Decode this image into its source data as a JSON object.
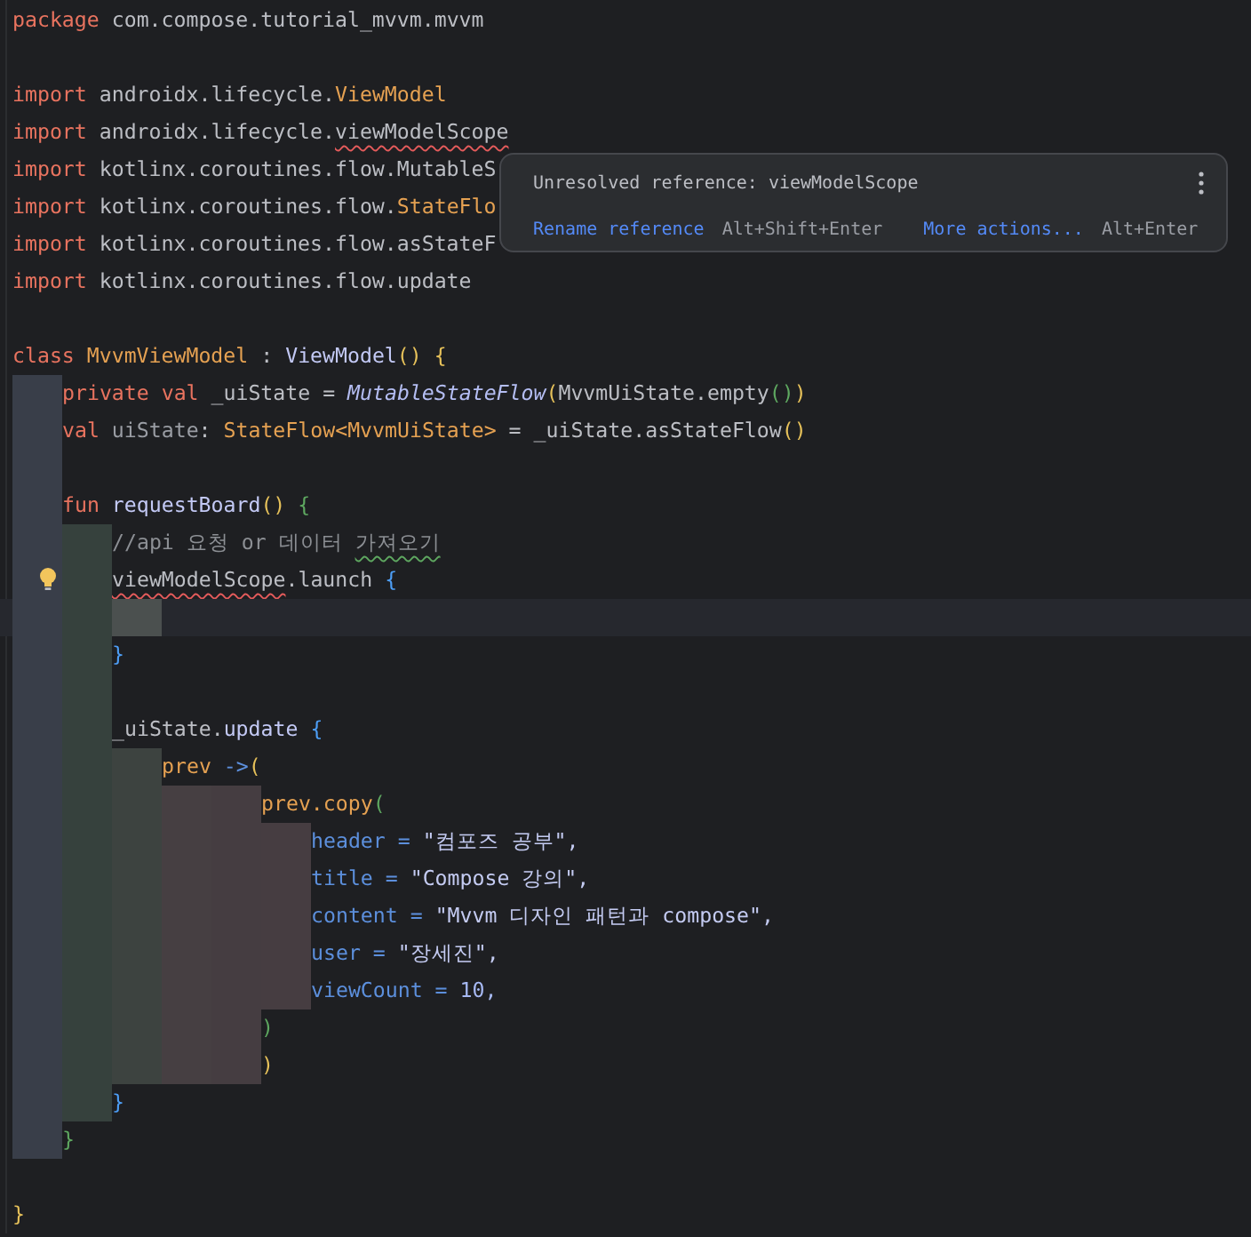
{
  "editor": {
    "lines": [
      {
        "current": false,
        "bulb": false,
        "tokens": [
          {
            "text": "package",
            "kind": "keyword"
          },
          {
            "text": " com.compose.tutorial_mvvm.mvvm",
            "kind": "plain"
          }
        ]
      },
      {
        "current": false,
        "bulb": false
      },
      {
        "current": false,
        "bulb": false,
        "tokens": [
          {
            "text": "import",
            "kind": "keyword"
          },
          {
            "text": " androidx.lifecycle.",
            "kind": "plain"
          },
          {
            "text": "ViewModel",
            "kind": "type"
          }
        ]
      },
      {
        "current": false,
        "bulb": false,
        "tokens": [
          {
            "text": "import",
            "kind": "keyword"
          },
          {
            "text": " androidx.lifecycle.",
            "kind": "plain"
          },
          {
            "text": "viewModelScope",
            "kind": "unresolved"
          }
        ]
      },
      {
        "current": false,
        "bulb": false,
        "tokens": [
          {
            "text": "import",
            "kind": "keyword"
          },
          {
            "text": " kotlinx.coroutines.flow.MutableS",
            "kind": "plain"
          }
        ]
      },
      {
        "current": false,
        "bulb": false,
        "tokens": [
          {
            "text": "import",
            "kind": "keyword"
          },
          {
            "text": " kotlinx.coroutines.flow.",
            "kind": "plain"
          },
          {
            "text": "StateFlo",
            "kind": "type"
          }
        ]
      },
      {
        "current": false,
        "bulb": false,
        "tokens": [
          {
            "text": "import",
            "kind": "keyword"
          },
          {
            "text": " kotlinx.coroutines.flow.asStateF",
            "kind": "plain"
          }
        ]
      },
      {
        "current": false,
        "bulb": false,
        "tokens": [
          {
            "text": "import",
            "kind": "keyword"
          },
          {
            "text": " kotlinx.coroutines.flow.update",
            "kind": "plain"
          }
        ]
      },
      {
        "current": false,
        "bulb": false
      },
      {
        "current": false,
        "bulb": false,
        "tokens": [
          {
            "text": "class",
            "kind": "keyword"
          },
          {
            "text": " MvvmViewModel",
            "kind": "type"
          },
          {
            "text": " : ",
            "kind": "plain"
          },
          {
            "text": "ViewModel",
            "kind": "call"
          },
          {
            "text": "()",
            "kind": "bracket1"
          },
          {
            "text": " {",
            "kind": "bracket1"
          }
        ]
      },
      {
        "current": false,
        "bulb": false,
        "tokens": [
          {
            "text": "    private val",
            "kind": "keyword"
          },
          {
            "text": " _uiState = ",
            "kind": "plain"
          },
          {
            "text": "MutableStateFlow",
            "kind": "italic"
          },
          {
            "text": "(",
            "kind": "bracket1"
          },
          {
            "text": "MvvmUiState.empty",
            "kind": "plain"
          },
          {
            "text": "()",
            "kind": "bracket2"
          },
          {
            "text": ")",
            "kind": "bracket1"
          }
        ]
      },
      {
        "current": false,
        "bulb": false,
        "tokens": [
          {
            "text": "    val",
            "kind": "keyword"
          },
          {
            "text": " uiState",
            "kind": "muted"
          },
          {
            "text": ": ",
            "kind": "plain"
          },
          {
            "text": "StateFlow<MvvmUiState>",
            "kind": "type"
          },
          {
            "text": " = _uiState.asStateFlow",
            "kind": "plain"
          },
          {
            "text": "()",
            "kind": "bracket1"
          }
        ]
      },
      {
        "current": false,
        "bulb": false
      },
      {
        "current": false,
        "bulb": false,
        "tokens": [
          {
            "text": "    fun",
            "kind": "keyword"
          },
          {
            "text": " requestBoard",
            "kind": "call"
          },
          {
            "text": "()",
            "kind": "bracket1"
          },
          {
            "text": " {",
            "kind": "bracket2"
          }
        ]
      },
      {
        "current": false,
        "bulb": false,
        "tokens": [
          {
            "text": "        //api 요청 or 데이터 ",
            "kind": "comment"
          },
          {
            "text": "가져오기",
            "kind": "misspelled"
          }
        ]
      },
      {
        "current": false,
        "bulb": true,
        "tokens": [
          {
            "text": "        viewModelScope",
            "kind": "unresolved"
          },
          {
            "text": ".launch ",
            "kind": "plain"
          },
          {
            "text": "{",
            "kind": "bracket3"
          }
        ]
      },
      {
        "current": true,
        "bulb": false
      },
      {
        "current": false,
        "bulb": false,
        "tokens": [
          {
            "text": "        }",
            "kind": "bracket3"
          }
        ]
      },
      {
        "current": false,
        "bulb": false
      },
      {
        "current": false,
        "bulb": false,
        "tokens": [
          {
            "text": "        _uiState.",
            "kind": "plain"
          },
          {
            "text": "update",
            "kind": "call"
          },
          {
            "text": " {",
            "kind": "bracket3"
          }
        ]
      },
      {
        "current": false,
        "bulb": false,
        "tokens": [
          {
            "text": "            prev",
            "kind": "type"
          },
          {
            "text": " ->",
            "kind": "param"
          },
          {
            "text": "(",
            "kind": "bracket1"
          }
        ]
      },
      {
        "current": false,
        "bulb": false,
        "tokens": [
          {
            "text": "                    prev.copy",
            "kind": "type"
          },
          {
            "text": "(",
            "kind": "bracket2"
          }
        ]
      },
      {
        "current": false,
        "bulb": false,
        "tokens": [
          {
            "text": "                        header = ",
            "kind": "param"
          },
          {
            "text": "\"컴포즈 공부\",",
            "kind": "string"
          }
        ]
      },
      {
        "current": false,
        "bulb": false,
        "tokens": [
          {
            "text": "                        title = ",
            "kind": "param"
          },
          {
            "text": "\"Compose 강의\",",
            "kind": "string"
          }
        ]
      },
      {
        "current": false,
        "bulb": false,
        "tokens": [
          {
            "text": "                        content = ",
            "kind": "param"
          },
          {
            "text": "\"Mvvm 디자인 패턴과 compose\",",
            "kind": "string"
          }
        ]
      },
      {
        "current": false,
        "bulb": false,
        "tokens": [
          {
            "text": "                        user = ",
            "kind": "param"
          },
          {
            "text": "\"장세진\",",
            "kind": "string"
          }
        ]
      },
      {
        "current": false,
        "bulb": false,
        "tokens": [
          {
            "text": "                        viewCount = ",
            "kind": "param"
          },
          {
            "text": "10,",
            "kind": "number"
          }
        ]
      },
      {
        "current": false,
        "bulb": false,
        "tokens": [
          {
            "text": "                    )",
            "kind": "bracket2"
          }
        ]
      },
      {
        "current": false,
        "bulb": false,
        "tokens": [
          {
            "text": "                    )",
            "kind": "bracket1"
          }
        ]
      },
      {
        "current": false,
        "bulb": false,
        "tokens": [
          {
            "text": "        }",
            "kind": "bracket3"
          }
        ]
      },
      {
        "current": false,
        "bulb": false,
        "tokens": [
          {
            "text": "    }",
            "kind": "bracket2"
          }
        ]
      },
      {
        "current": false,
        "bulb": false
      },
      {
        "current": false,
        "bulb": false,
        "tokens": [
          {
            "text": "}",
            "kind": "bracket1"
          }
        ]
      }
    ]
  },
  "popup": {
    "message": "Unresolved reference: viewModelScope",
    "actions": [
      {
        "label": "Rename reference",
        "shortcut": "Alt+Shift+Enter"
      },
      {
        "label": "More actions...",
        "shortcut": "Alt+Enter"
      }
    ]
  }
}
